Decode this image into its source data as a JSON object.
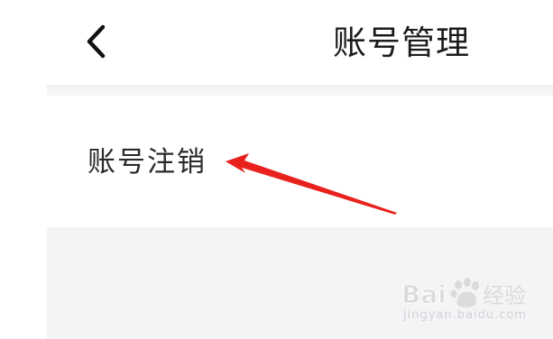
{
  "header": {
    "back_icon": "chevron-left-icon",
    "title": "账号管理"
  },
  "list": {
    "items": [
      {
        "label": "账号注销"
      }
    ]
  },
  "annotation": {
    "color": "#e8211c",
    "type": "arrow pointing to list item"
  },
  "watermark": {
    "logo": "Bai经验",
    "sub": "jingyan.baidu.com"
  },
  "colors": {
    "background": "#ffffff",
    "section_bg": "#f4f4f6",
    "text": "#2a2a2a",
    "annotation_red": "#e8211c"
  }
}
